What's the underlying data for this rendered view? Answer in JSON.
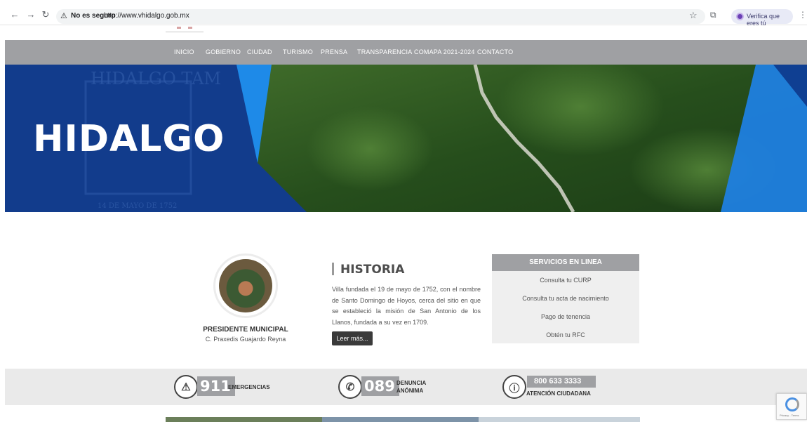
{
  "browser": {
    "security_label": "No es seguro",
    "url": "http://www.vhidalgo.gob.mx",
    "profile_label": "Verifica que eres tú"
  },
  "menu": {
    "items": [
      "INICIO",
      "GOBIERNO",
      "CIUDAD",
      "TURISMO",
      "PRENSA",
      "TRANSPARENCIA",
      "COMAPA 2021-2024",
      "CONTACTO"
    ]
  },
  "hero": {
    "title": "HIDALGO",
    "watermark_top": "HIDALGO TAM",
    "watermark_bottom": "14 DE MAYO DE 1752"
  },
  "president": {
    "title": "PRESIDENTE MUNICIPAL",
    "name": "C. Praxedis Guajardo Reyna"
  },
  "historia": {
    "title": "HISTORIA",
    "text": "Villa fundada el 19 de mayo de 1752, con el nombre de Santo Domingo de Hoyos, cerca del sitio en que se estableció la misión de San Antonio de los Llanos, fundada a su vez en 1709.",
    "button": "Leer más..."
  },
  "servicios": {
    "title": "SERVICIOS EN LINEA",
    "items": [
      "Consulta tu CURP",
      "Consulta tu acta de nacimiento",
      "Pago de tenencia",
      "Obtén tu RFC"
    ]
  },
  "hotlines": {
    "emergency": {
      "number": "911",
      "label": "EMERGENCIAS"
    },
    "denuncia": {
      "number": "089",
      "label_1": "DENUNCIA",
      "label_2": "ANÓNIMA"
    },
    "atencion": {
      "number": "800 633 3333",
      "label": "ATENCIÓN CIUDADANA"
    }
  },
  "recaptcha": {
    "text": "Privacy - Terms"
  }
}
